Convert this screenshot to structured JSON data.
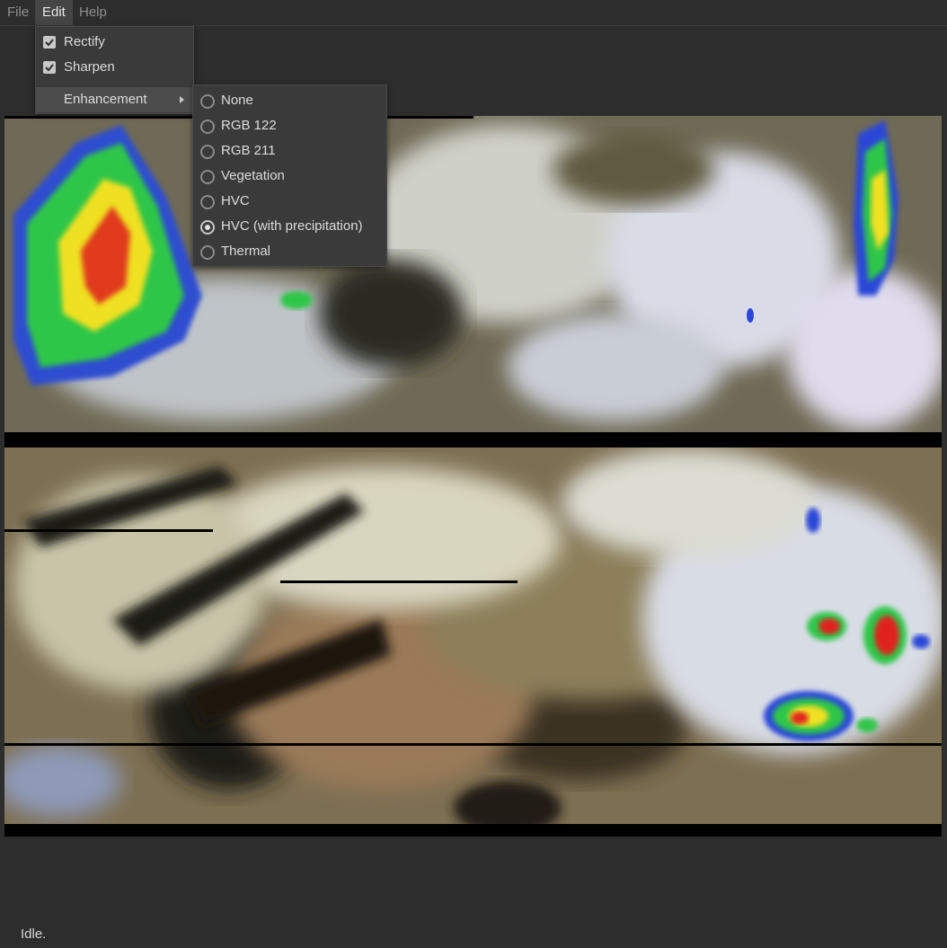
{
  "menubar": {
    "items": [
      {
        "label": "File"
      },
      {
        "label": "Edit"
      },
      {
        "label": "Help"
      }
    ]
  },
  "edit_menu": {
    "items": [
      {
        "label": "Rectify",
        "checked": true
      },
      {
        "label": "Sharpen",
        "checked": true
      },
      {
        "label": "Enhancement",
        "has_submenu": true
      }
    ]
  },
  "enhancement_menu": {
    "selected": "HVC (with precipitation)",
    "items": [
      {
        "label": "None"
      },
      {
        "label": "RGB 122"
      },
      {
        "label": "RGB 211"
      },
      {
        "label": "Vegetation"
      },
      {
        "label": "HVC"
      },
      {
        "label": "HVC (with precipitation)"
      },
      {
        "label": "Thermal"
      }
    ]
  },
  "image": {
    "description_colors": {
      "land": "#8a7a58",
      "cloud": "#d6d8cf",
      "sea": "#2f2b1e",
      "precip_green": "#2fc83a",
      "precip_yellow": "#f4e21a",
      "precip_red": "#e0241a",
      "precip_blue": "#2a46d8"
    }
  },
  "status": {
    "text": "Idle."
  }
}
